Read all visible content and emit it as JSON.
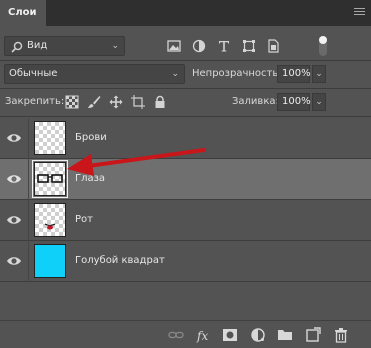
{
  "panel": {
    "tab_label": "Слои",
    "menu_icon": "panel-menu-icon"
  },
  "filter": {
    "kind_value": "Вид",
    "icons": [
      "pixel-layer-filter-icon",
      "adjustment-layer-filter-icon",
      "type-layer-filter-icon",
      "shape-layer-filter-icon",
      "smart-object-filter-icon"
    ],
    "toggle_on": true
  },
  "blend": {
    "mode_value": "Обычные",
    "opacity_label": "Непрозрачность:",
    "opacity_value": "100%"
  },
  "lock": {
    "label": "Закрепить:",
    "icons": [
      "lock-transparent-pixels-icon",
      "lock-image-pixels-icon",
      "lock-position-icon",
      "lock-artboard-icon",
      "lock-all-icon"
    ],
    "fill_label": "Заливка:",
    "fill_value": "100%"
  },
  "layers": [
    {
      "name": "Брови",
      "visible": true,
      "selected": false,
      "thumb": "eyebrows-thumbnail"
    },
    {
      "name": "Глаза",
      "visible": true,
      "selected": true,
      "thumb": "glasses-thumbnail"
    },
    {
      "name": "Рот",
      "visible": true,
      "selected": false,
      "thumb": "mouth-thumbnail"
    },
    {
      "name": "Голубой квадрат",
      "visible": true,
      "selected": false,
      "thumb": "blue-square-thumbnail"
    }
  ],
  "colors": {
    "blue_square": "#0ed0f9",
    "annotation_arrow": "#c8161b",
    "selected_row": "#6f6f6f"
  },
  "bottom_icons": [
    "link-layers-icon",
    "fx-icon",
    "layer-mask-icon",
    "adjustment-layer-icon",
    "group-folder-icon",
    "new-layer-icon",
    "trash-icon"
  ]
}
